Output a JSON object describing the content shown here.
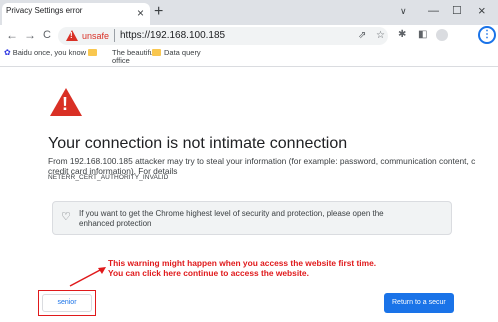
{
  "tab": {
    "title": "Privacy Settings error",
    "close_icon": "close-icon",
    "new_tab_icon": "plus-icon"
  },
  "window_controls": {
    "chevron": "chevron-down-icon",
    "minimize": "minimize-icon",
    "maximize": "maximize-icon",
    "close": "close-icon"
  },
  "toolbar": {
    "back_icon": "arrow-left-icon",
    "forward_icon": "arrow-right-icon",
    "reload_icon": "reload-icon",
    "security_label": "unsafe",
    "url": "https://192.168.100.185",
    "share_icon": "share-icon",
    "star_icon": "star-icon",
    "extensions_icon": "puzzle-icon",
    "side_panel_icon": "side-panel-icon",
    "profile_icon": "profile-icon",
    "menu_icon": "more-vert-icon"
  },
  "bookmarks": [
    {
      "label": "Baidu once, you know",
      "icon": "baidu-paw-icon"
    },
    {
      "label": "The beautiful office",
      "icon": "folder-icon"
    },
    {
      "label": "Data query",
      "icon": "folder-icon"
    }
  ],
  "page": {
    "heading": "Your connection is not intimate connection",
    "description": "From 192.168.100.185 attacker may try to steal your information (for example: password, communication content, c credit card information). For details",
    "error_code": "NETERR_CERT_AUTHORITY_INVALID",
    "promo_text": "If you want to get the Chrome highest level of security and protection, please open the enhanced protection",
    "promo_icon": "lightbulb-icon",
    "annotation_line1": "This warning might happen when you access the website first time.",
    "annotation_line2": "You can click here continue to access the website.",
    "senior_button": "senior",
    "return_button": "Return to a secur"
  },
  "colors": {
    "warning_red": "#d93025",
    "annotation_red": "#e0191b",
    "primary_blue": "#1a73e8",
    "tabstrip_gray": "#dee1e6"
  }
}
